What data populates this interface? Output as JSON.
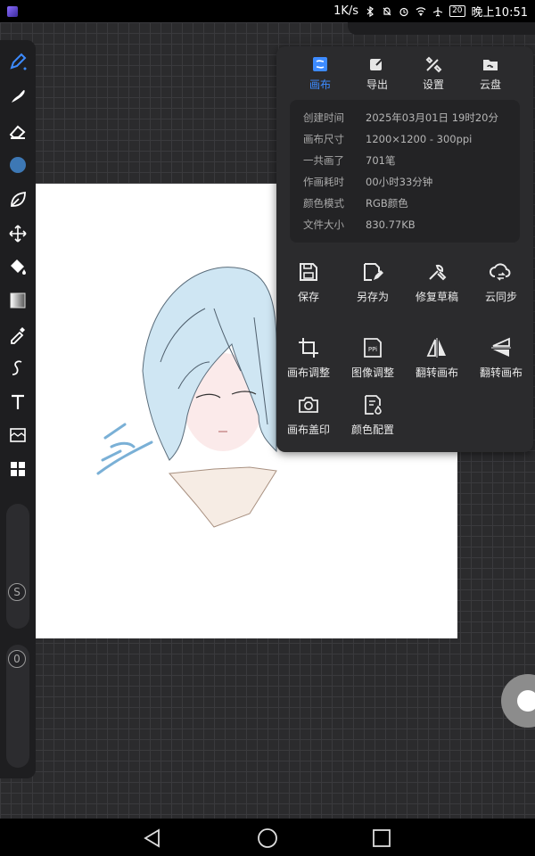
{
  "status_bar": {
    "net_speed": "1K/s",
    "battery": "20",
    "time": "晚上10:51"
  },
  "toolbar": {
    "tools": [
      "brush-pen-icon",
      "smudge-icon",
      "eraser-icon",
      "color-swatch",
      "leaf-brush-icon",
      "move-transform-icon",
      "fill-bucket-icon",
      "gradient-icon",
      "eyedropper-icon",
      "curve-icon",
      "text-icon",
      "layer-image-icon",
      "grid-layout-icon"
    ],
    "active_color": "#3d78b5",
    "size_slider_label": "S",
    "opacity_slider_label": "0"
  },
  "menu": {
    "tabs": [
      {
        "label": "画布",
        "icon": "canvas-icon",
        "active": true
      },
      {
        "label": "导出",
        "icon": "export-icon",
        "active": false
      },
      {
        "label": "设置",
        "icon": "settings-tools-icon",
        "active": false
      },
      {
        "label": "云盘",
        "icon": "cloud-drive-icon",
        "active": false
      }
    ],
    "info": [
      {
        "key": "创建时间",
        "value": "2025年03月01日 19时20分"
      },
      {
        "key": "画布尺寸",
        "value": "1200×1200 - 300ppi"
      },
      {
        "key": "一共画了",
        "value": "701笔"
      },
      {
        "key": "作画耗时",
        "value": "00小时33分钟"
      },
      {
        "key": "颜色模式",
        "value": "RGB颜色"
      },
      {
        "key": "文件大小",
        "value": "830.77KB"
      }
    ],
    "actions": [
      {
        "label": "保存",
        "icon": "save-icon"
      },
      {
        "label": "另存为",
        "icon": "save-as-icon"
      },
      {
        "label": "修复草稿",
        "icon": "wrench-icon"
      },
      {
        "label": "云同步",
        "icon": "cloud-sync-icon"
      },
      {
        "label": "画布调整",
        "icon": "crop-icon"
      },
      {
        "label": "图像调整",
        "icon": "ppi-icon"
      },
      {
        "label": "翻转画布",
        "icon": "flip-horizontal-icon"
      },
      {
        "label": "翻转画布",
        "icon": "flip-vertical-icon"
      },
      {
        "label": "画布盖印",
        "icon": "camera-icon"
      },
      {
        "label": "颜色配置",
        "icon": "color-profile-icon"
      }
    ]
  },
  "accent_color": "#3d8bff"
}
